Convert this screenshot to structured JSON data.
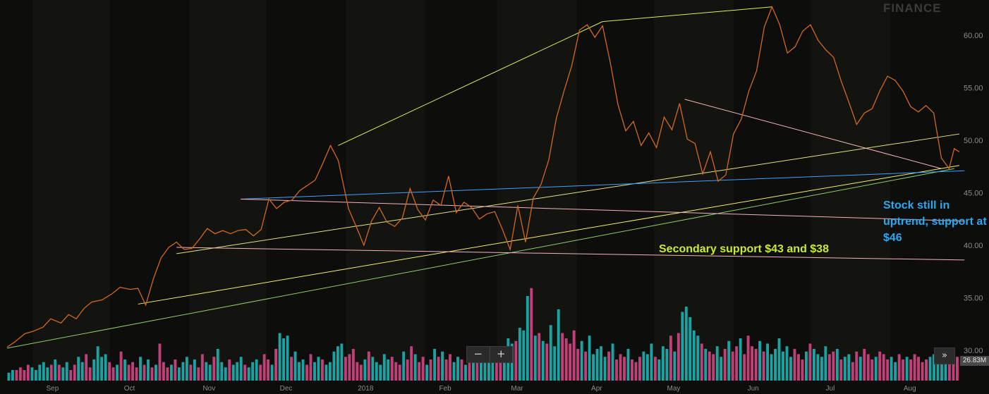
{
  "watermark": "FINANCE",
  "annotations": {
    "primary_support": "Stock still in uptrend, support at $46",
    "secondary_support": "Secondary support $43 and $38"
  },
  "controls": {
    "zoom_out": "−",
    "zoom_in": "+",
    "scroll_right": "»"
  },
  "volume_badge": "26.83M",
  "colors": {
    "background": "#0d0d0b",
    "price_line": "#d2691e",
    "volume_up": "#1aa3a3",
    "volume_down": "#c2407a",
    "blue_annotation": "#29a8f0",
    "green_annotation": "#c8ec2c",
    "axis_text": "#8c8c8c"
  },
  "chart_data": {
    "type": "line",
    "title": "",
    "xlabel": "",
    "ylabel": "",
    "ylim": [
      29,
      63
    ],
    "x_range": [
      "2017-08-22",
      "2018-08-28"
    ],
    "y_ticks": [
      "30.00",
      "35.00",
      "40.00",
      "45.00",
      "50.00",
      "55.00",
      "60.00"
    ],
    "x_ticks": [
      {
        "label": "Sep",
        "date": "2017-09-01"
      },
      {
        "label": "Oct",
        "date": "2017-10-01"
      },
      {
        "label": "Nov",
        "date": "2017-11-01"
      },
      {
        "label": "Dec",
        "date": "2017-12-01"
      },
      {
        "label": "2018",
        "date": "2018-01-01"
      },
      {
        "label": "Feb",
        "date": "2018-02-01"
      },
      {
        "label": "Mar",
        "date": "2018-03-01"
      },
      {
        "label": "Apr",
        "date": "2018-04-01"
      },
      {
        "label": "May",
        "date": "2018-05-01"
      },
      {
        "label": "Jun",
        "date": "2018-06-01"
      },
      {
        "label": "Jul",
        "date": "2018-07-01"
      },
      {
        "label": "Aug",
        "date": "2018-08-01"
      }
    ],
    "series": [
      {
        "points": [
          [
            "2017-08-22",
            30.3
          ],
          [
            "2017-08-25",
            30.8
          ],
          [
            "2017-08-29",
            31.6
          ],
          [
            "2017-09-01",
            31.8
          ],
          [
            "2017-09-05",
            32.2
          ],
          [
            "2017-09-08",
            33.0
          ],
          [
            "2017-09-12",
            32.6
          ],
          [
            "2017-09-15",
            33.4
          ],
          [
            "2017-09-18",
            33.0
          ],
          [
            "2017-09-21",
            34.0
          ],
          [
            "2017-09-24",
            34.6
          ],
          [
            "2017-09-28",
            34.8
          ],
          [
            "2017-10-02",
            35.4
          ],
          [
            "2017-10-05",
            36.0
          ],
          [
            "2017-10-09",
            35.8
          ],
          [
            "2017-10-12",
            35.9
          ],
          [
            "2017-10-15",
            34.3
          ],
          [
            "2017-10-18",
            36.8
          ],
          [
            "2017-10-21",
            38.8
          ],
          [
            "2017-10-24",
            39.8
          ],
          [
            "2017-10-27",
            40.3
          ],
          [
            "2017-10-30",
            39.6
          ],
          [
            "2017-11-02",
            39.7
          ],
          [
            "2017-11-05",
            40.6
          ],
          [
            "2017-11-08",
            41.6
          ],
          [
            "2017-11-11",
            41.1
          ],
          [
            "2017-11-14",
            41.4
          ],
          [
            "2017-11-17",
            41.1
          ],
          [
            "2017-11-20",
            41.4
          ],
          [
            "2017-11-23",
            41.5
          ],
          [
            "2017-11-26",
            40.9
          ],
          [
            "2017-11-29",
            41.5
          ],
          [
            "2017-12-02",
            44.4
          ],
          [
            "2017-12-05",
            43.5
          ],
          [
            "2017-12-08",
            44.1
          ],
          [
            "2017-12-11",
            44.3
          ],
          [
            "2017-12-14",
            45.2
          ],
          [
            "2017-12-17",
            45.7
          ],
          [
            "2017-12-20",
            46.2
          ],
          [
            "2017-12-23",
            47.8
          ],
          [
            "2017-12-26",
            49.5
          ],
          [
            "2017-12-29",
            48.1
          ],
          [
            "2018-01-02",
            43.5
          ],
          [
            "2018-01-05",
            41.8
          ],
          [
            "2018-01-08",
            40.0
          ],
          [
            "2018-01-11",
            42.3
          ],
          [
            "2018-01-14",
            43.6
          ],
          [
            "2018-01-17",
            42.2
          ],
          [
            "2018-01-20",
            41.8
          ],
          [
            "2018-01-23",
            42.6
          ],
          [
            "2018-01-26",
            45.4
          ],
          [
            "2018-01-29",
            43.4
          ],
          [
            "2018-02-01",
            42.4
          ],
          [
            "2018-02-04",
            44.3
          ],
          [
            "2018-02-07",
            43.8
          ],
          [
            "2018-02-10",
            46.6
          ],
          [
            "2018-02-13",
            43.1
          ],
          [
            "2018-02-16",
            44.1
          ],
          [
            "2018-02-19",
            43.6
          ],
          [
            "2018-02-22",
            42.5
          ],
          [
            "2018-02-25",
            43.0
          ],
          [
            "2018-02-28",
            43.2
          ],
          [
            "2018-03-03",
            41.5
          ],
          [
            "2018-03-06",
            39.6
          ],
          [
            "2018-03-09",
            43.8
          ],
          [
            "2018-03-12",
            40.3
          ],
          [
            "2018-03-15",
            44.5
          ],
          [
            "2018-03-18",
            45.8
          ],
          [
            "2018-03-21",
            48.1
          ],
          [
            "2018-03-24",
            52.1
          ],
          [
            "2018-03-27",
            54.7
          ],
          [
            "2018-03-30",
            57.1
          ],
          [
            "2018-04-02",
            60.5
          ],
          [
            "2018-04-05",
            61.0
          ],
          [
            "2018-04-08",
            59.8
          ],
          [
            "2018-04-11",
            60.9
          ],
          [
            "2018-04-14",
            57.4
          ],
          [
            "2018-04-17",
            53.4
          ],
          [
            "2018-04-20",
            50.9
          ],
          [
            "2018-04-23",
            51.8
          ],
          [
            "2018-04-26",
            49.5
          ],
          [
            "2018-04-29",
            50.7
          ],
          [
            "2018-05-02",
            49.3
          ],
          [
            "2018-05-05",
            52.2
          ],
          [
            "2018-05-08",
            51.0
          ],
          [
            "2018-05-11",
            53.5
          ],
          [
            "2018-05-14",
            50.1
          ],
          [
            "2018-05-17",
            49.7
          ],
          [
            "2018-05-20",
            46.8
          ],
          [
            "2018-05-23",
            48.9
          ],
          [
            "2018-05-26",
            46.1
          ],
          [
            "2018-05-29",
            46.7
          ],
          [
            "2018-06-01",
            50.6
          ],
          [
            "2018-06-04",
            52.0
          ],
          [
            "2018-06-07",
            54.7
          ],
          [
            "2018-06-10",
            56.6
          ],
          [
            "2018-06-13",
            60.8
          ],
          [
            "2018-06-16",
            62.7
          ],
          [
            "2018-06-19",
            61.0
          ],
          [
            "2018-06-22",
            58.3
          ],
          [
            "2018-06-25",
            58.9
          ],
          [
            "2018-06-28",
            60.4
          ],
          [
            "2018-07-01",
            61.0
          ],
          [
            "2018-07-04",
            59.5
          ],
          [
            "2018-07-07",
            58.6
          ],
          [
            "2018-07-10",
            57.9
          ],
          [
            "2018-07-13",
            55.6
          ],
          [
            "2018-07-16",
            53.6
          ],
          [
            "2018-07-19",
            51.5
          ],
          [
            "2018-07-22",
            52.6
          ],
          [
            "2018-07-25",
            53.0
          ],
          [
            "2018-07-28",
            54.7
          ],
          [
            "2018-07-31",
            56.1
          ],
          [
            "2018-08-03",
            55.7
          ],
          [
            "2018-08-06",
            54.7
          ],
          [
            "2018-08-09",
            53.2
          ],
          [
            "2018-08-12",
            52.7
          ],
          [
            "2018-08-15",
            53.3
          ],
          [
            "2018-08-18",
            52.6
          ],
          [
            "2018-08-21",
            48.3
          ],
          [
            "2018-08-24",
            47.3
          ],
          [
            "2018-08-26",
            49.2
          ],
          [
            "2018-08-28",
            48.9
          ]
        ]
      }
    ],
    "volume": {
      "ylim": [
        0,
        40
      ],
      "values": [
        3,
        4,
        4,
        5,
        4,
        6,
        5,
        4,
        6,
        7,
        5,
        6,
        8,
        6,
        5,
        7,
        4,
        6,
        9,
        7,
        10,
        5,
        8,
        13,
        9,
        10,
        7,
        5,
        6,
        11,
        8,
        6,
        7,
        5,
        9,
        6,
        8,
        5,
        6,
        14,
        7,
        5,
        6,
        8,
        5,
        7,
        9,
        6,
        8,
        5,
        10,
        7,
        6,
        9,
        12,
        7,
        5,
        8,
        6,
        7,
        9,
        6,
        5,
        7,
        8,
        6,
        10,
        8,
        6,
        12,
        18,
        16,
        17,
        9,
        11,
        7,
        8,
        6,
        10,
        7,
        9,
        8,
        6,
        7,
        11,
        13,
        14,
        9,
        10,
        12,
        7,
        6,
        8,
        11,
        9,
        7,
        6,
        10,
        8,
        9,
        7,
        6,
        11,
        8,
        13,
        10,
        7,
        9,
        6,
        8,
        12,
        9,
        11,
        8,
        10,
        7,
        9,
        8,
        6,
        11,
        9,
        8,
        12,
        10,
        11,
        13,
        10,
        9,
        12,
        16,
        14,
        15,
        20,
        19,
        32,
        35,
        17,
        18,
        15,
        14,
        21,
        13,
        27,
        18,
        16,
        14,
        19,
        12,
        15,
        11,
        17,
        10,
        12,
        13,
        9,
        11,
        14,
        8,
        10,
        9,
        12,
        8,
        7,
        9,
        11,
        10,
        14,
        9,
        8,
        13,
        12,
        17,
        11,
        18,
        26,
        28,
        24,
        19,
        17,
        14,
        12,
        11,
        10,
        13,
        9,
        12,
        15,
        11,
        13,
        16,
        10,
        17,
        13,
        12,
        15,
        11,
        14,
        10,
        12,
        16,
        11,
        13,
        9,
        12,
        10,
        8,
        11,
        14,
        12,
        10,
        9,
        13,
        10,
        11,
        12,
        8,
        9,
        10,
        7,
        11,
        9,
        12,
        10,
        8,
        9,
        11,
        10,
        8,
        9,
        7,
        10,
        8,
        9,
        8,
        10,
        9,
        7,
        8,
        9,
        10,
        8,
        7,
        9,
        8,
        10,
        9
      ]
    },
    "trendlines": [
      {
        "color": "#d8f060",
        "from": [
          "2017-12-29",
          49.5
        ],
        "to": [
          "2018-04-11",
          61.3
        ]
      },
      {
        "color": "#d8f060",
        "from": [
          "2018-04-11",
          61.3
        ],
        "to": [
          "2018-06-16",
          62.7
        ]
      },
      {
        "color": "#f4b3c2",
        "from": [
          "2018-05-13",
          53.9
        ],
        "to": [
          "2018-08-21",
          47.3
        ]
      },
      {
        "color": "#e5e580",
        "from": [
          "2017-10-27",
          39.2
        ],
        "to": [
          "2018-08-28",
          50.6
        ]
      },
      {
        "color": "#f5f070",
        "from": [
          "2017-10-12",
          34.4
        ],
        "to": [
          "2018-08-28",
          47.6
        ]
      },
      {
        "color": "#8fcf66",
        "from": [
          "2017-08-22",
          30.2
        ],
        "to": [
          "2018-08-26",
          47.3
        ]
      },
      {
        "color": "#3ea2ff",
        "from": [
          "2017-11-21",
          44.4
        ],
        "to": [
          "2018-08-30",
          47.1
        ]
      },
      {
        "color": "#f4b3c2",
        "from": [
          "2017-11-21",
          44.4
        ],
        "to": [
          "2018-08-30",
          42.3
        ]
      },
      {
        "color": "#f4b3c2",
        "from": [
          "2017-10-27",
          39.8
        ],
        "to": [
          "2018-08-30",
          38.6
        ]
      }
    ]
  }
}
